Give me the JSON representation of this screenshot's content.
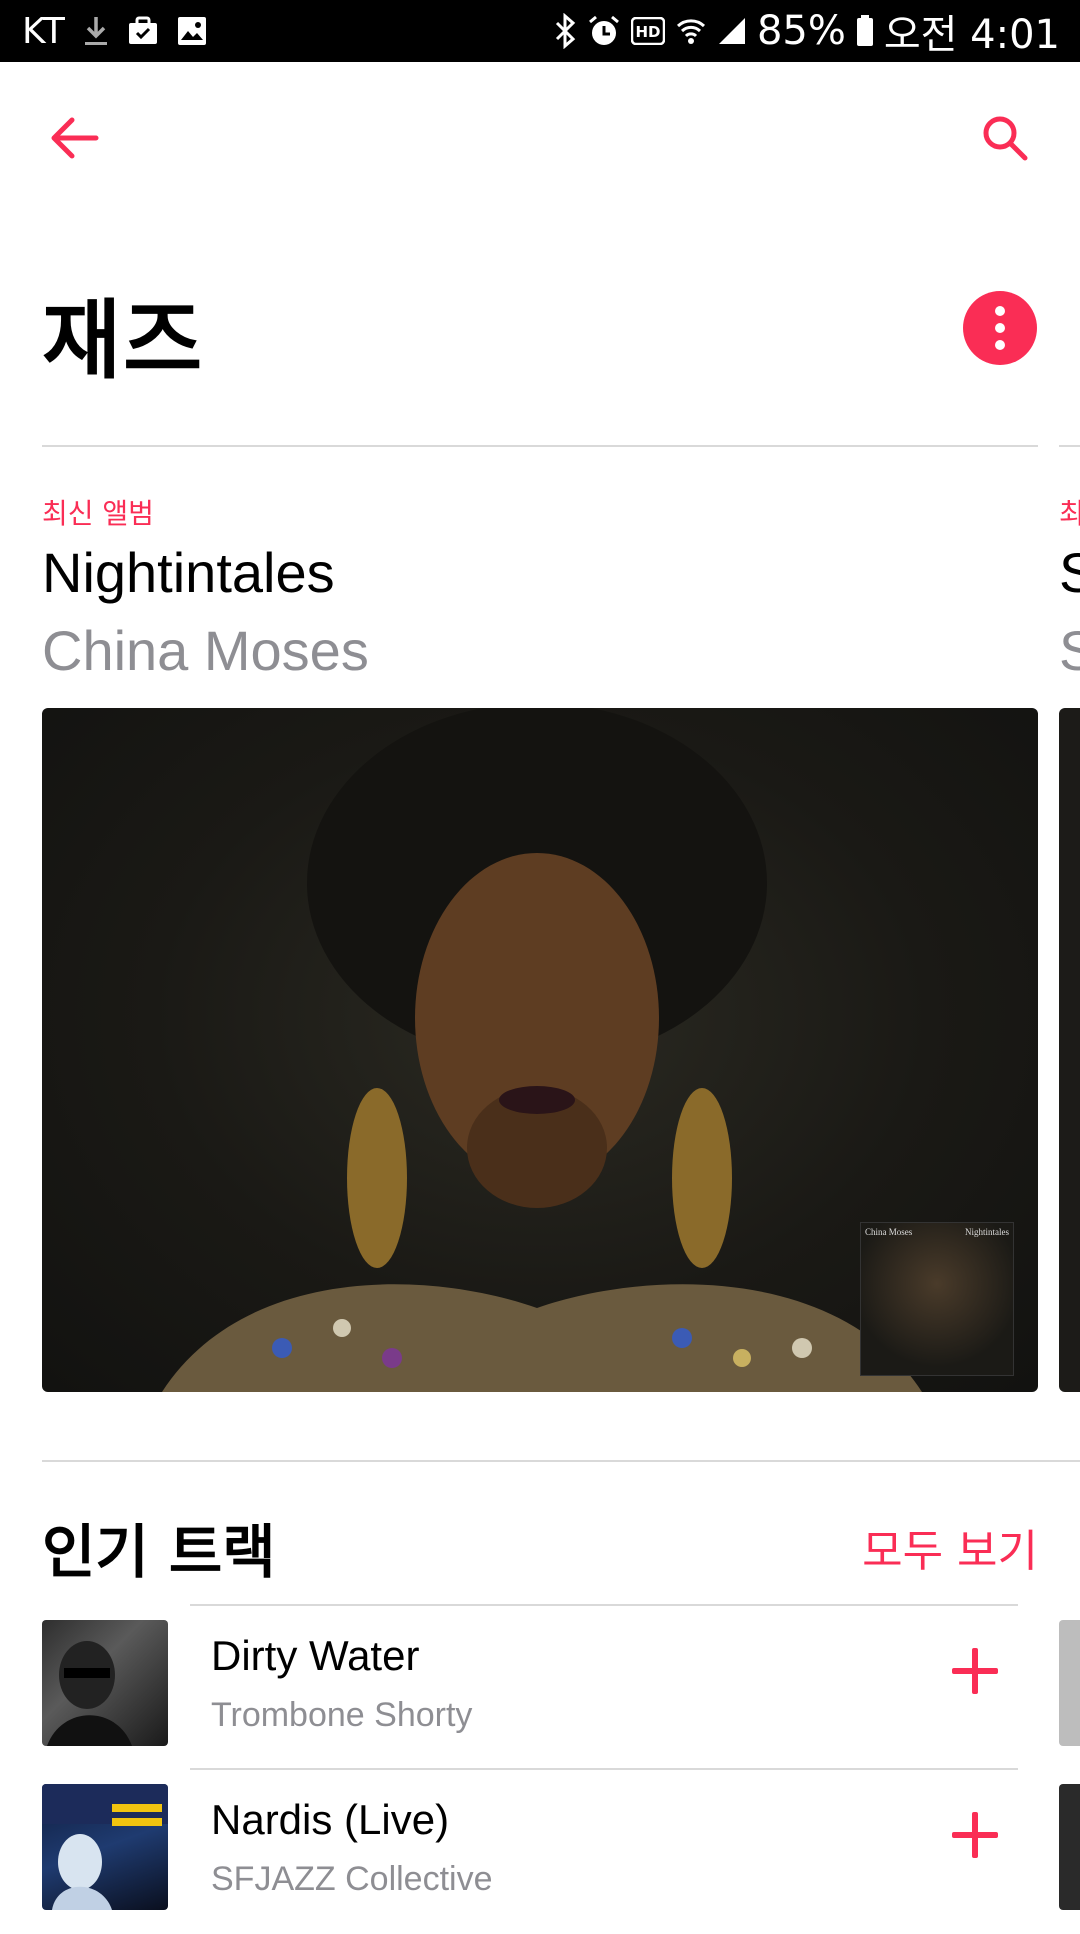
{
  "status_bar": {
    "carrier": "KT",
    "battery": "85%",
    "time": "오전 4:01",
    "icons": [
      "download-icon",
      "bag-icon",
      "image-icon",
      "bluetooth-icon",
      "alarm-icon",
      "hd-icon",
      "wifi-icon",
      "signal-icon",
      "battery-icon"
    ]
  },
  "nav": {
    "back_icon": "arrow-left-icon",
    "search_icon": "search-icon"
  },
  "header": {
    "title": "재즈",
    "more_icon": "more-vertical-icon"
  },
  "featured": {
    "eyebrow": "최신 앨범",
    "title": "Nightintales",
    "artist": "China Moses",
    "cover_text": {
      "artist": "China Moses",
      "title": "Nightintales"
    },
    "peek": {
      "eyebrow": "최",
      "title": "S",
      "artist": "S"
    }
  },
  "popular": {
    "title": "인기 트랙",
    "see_all": "모두 보기",
    "tracks": [
      {
        "title": "Dirty Water",
        "artist": "Trombone Shorty"
      },
      {
        "title": "Nardis (Live)",
        "artist": "SFJAZZ Collective"
      }
    ]
  },
  "colors": {
    "accent": "#fa2d55",
    "secondary_text": "#8e8e93",
    "divider": "#d9d9d9"
  }
}
